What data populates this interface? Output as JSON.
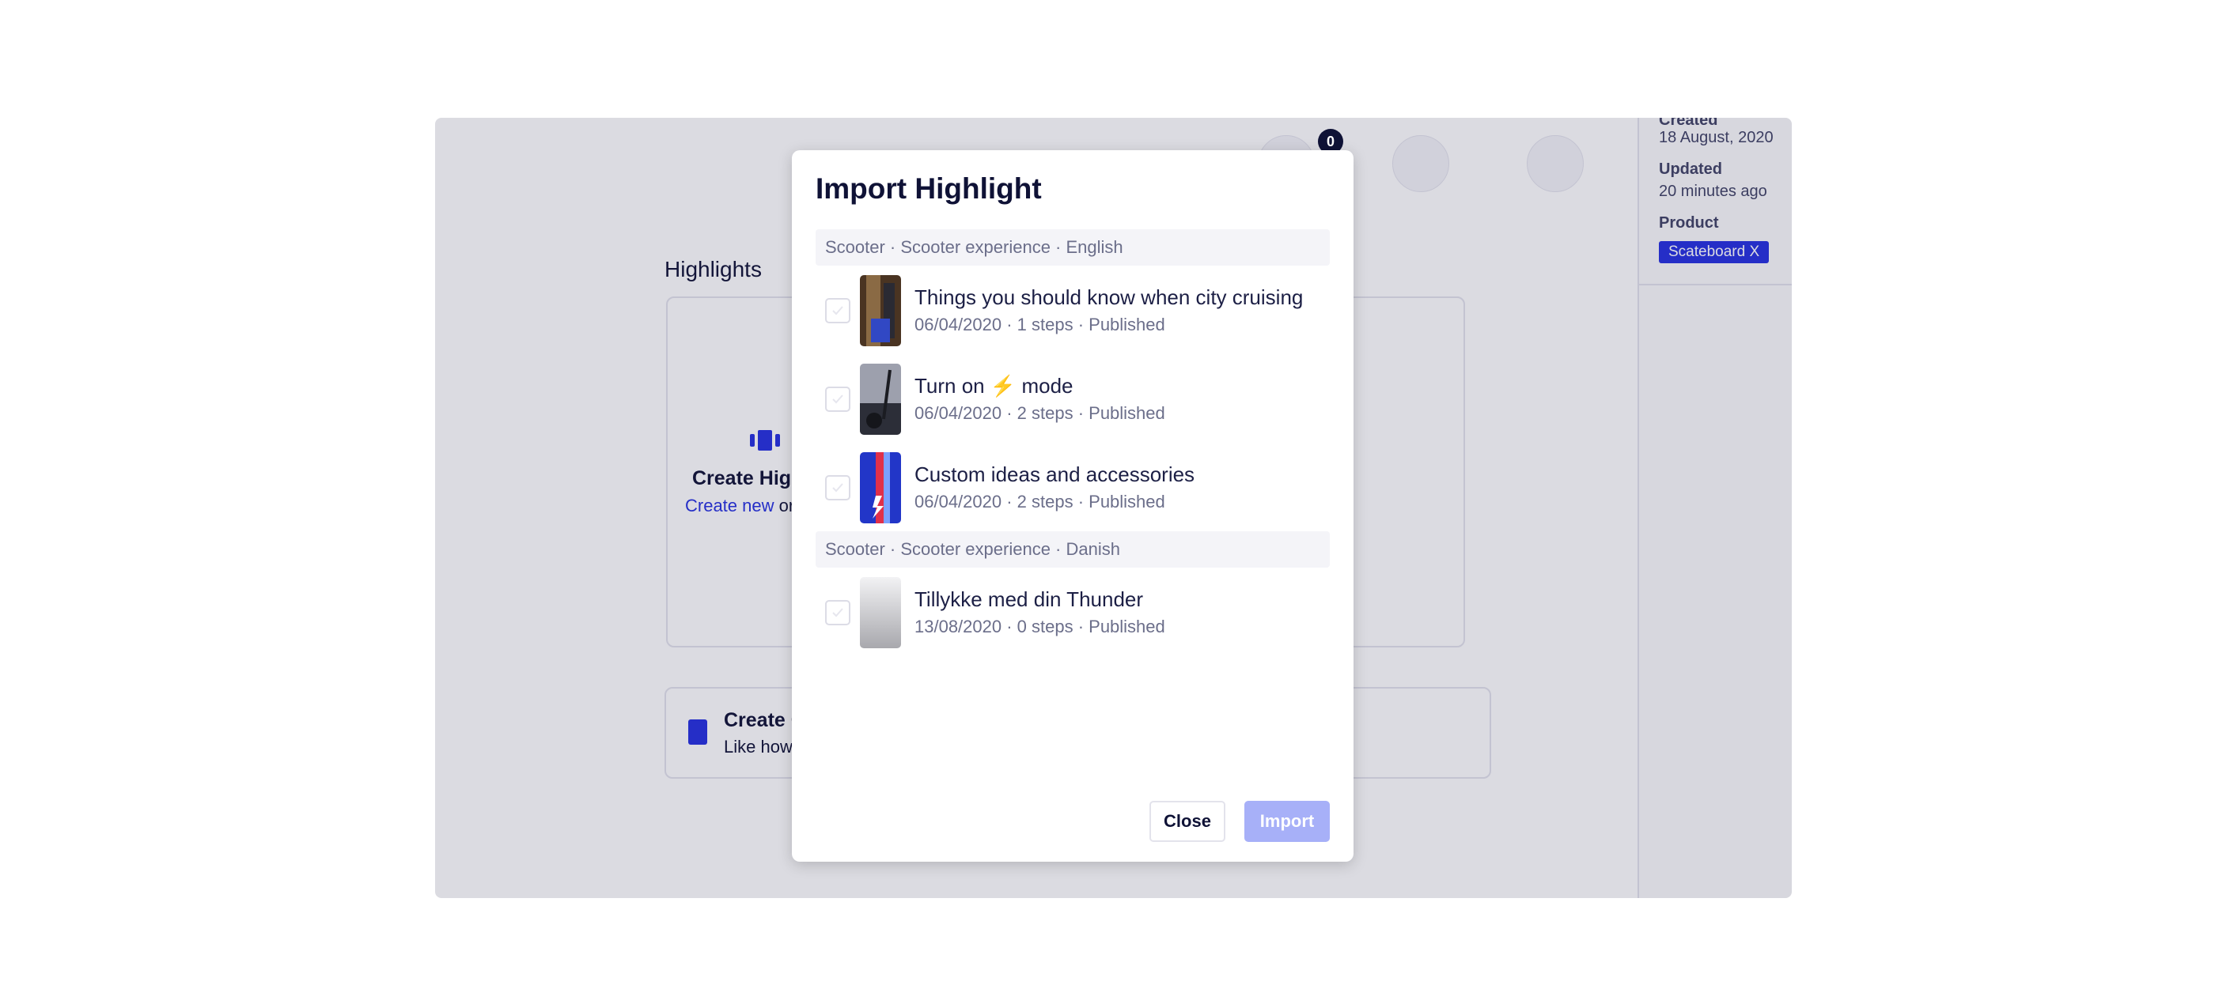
{
  "background": {
    "nav_badge_count": "0",
    "sidebar": {
      "created_label": "Created",
      "created_value": "18 August, 2020",
      "updated_label": "Updated",
      "updated_value": "20 minutes ago",
      "product_label": "Product",
      "product_tag": "Scateboard X"
    },
    "highlights_title": "Highlights",
    "create_highlight_title": "Create High",
    "create_highlight_link": "Create new",
    "create_highlight_rest": " or",
    "create_card_title": "Create C",
    "create_card_sub": "Like how t"
  },
  "modal": {
    "title": "Import Highlight",
    "groups": [
      {
        "header": "Scooter · Scooter experience · English",
        "items": [
          {
            "title": "Things you should know when city cruising",
            "meta": "06/04/2020 · 1 steps · Published",
            "thumb_color": "#6b4a2e"
          },
          {
            "title": "Turn on ⚡ mode",
            "meta": "06/04/2020 · 2 steps · Published",
            "thumb_color": "#3a3d4a"
          },
          {
            "title": "Custom ideas and accessories",
            "meta": "06/04/2020 · 2 steps · Published",
            "thumb_color": "#2b3fb8"
          }
        ]
      },
      {
        "header": "Scooter · Scooter experience · Danish",
        "items": [
          {
            "title": "Tillykke med din Thunder",
            "meta": "13/08/2020 · 0 steps · Published",
            "thumb_color": "#c8c8cc"
          }
        ]
      }
    ],
    "close_label": "Close",
    "import_label": "Import"
  }
}
